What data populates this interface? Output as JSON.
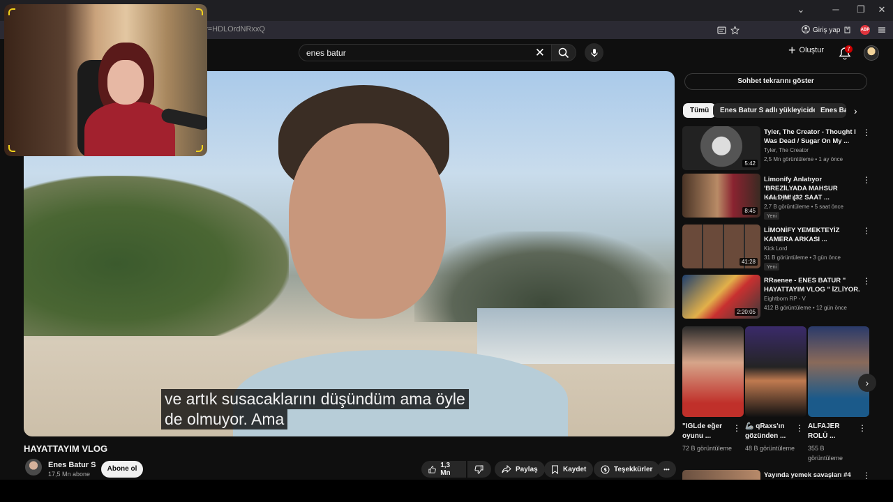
{
  "browser": {
    "url": "h?v=HDLOrdNRxxQ",
    "login_label": "Giriş yap",
    "abp_label": "ABP",
    "min_label": "─",
    "restore_label": "❐",
    "close_label": "✕",
    "tab_dropdown": "⌄"
  },
  "header": {
    "search_value": "enes batur",
    "clear_symbol": "✕",
    "create_label": "Oluştur",
    "notification_count": "7"
  },
  "video": {
    "subtitle_line1": "ve artık susacaklarını düşündüm ama öyle",
    "subtitle_line2": "de olmuyor. Ama",
    "title": "HAYATTAYIM VLOG",
    "channel": "Enes Batur S",
    "subscribers": "17,5 Mn abone",
    "subscribe_label": "Abone ol",
    "like_count": "1,3 Mn",
    "share_label": "Paylaş",
    "save_label": "Kaydet",
    "thanks_label": "Teşekkürler",
    "more_label": "•••"
  },
  "sidebar": {
    "chat_label": "Sohbet tekrarını göster",
    "chips": [
      "Tümü",
      "Enes Batur S adlı yükleyiciden",
      "Enes Ba"
    ],
    "recommendations": [
      {
        "title": "Tyler, The Creator - Thought I Was Dead / Sugar On My ...",
        "channel": "Tyler, The Creator",
        "meta": "2,5 Mn görüntüleme • 1 ay önce",
        "duration": "5:42",
        "badge": ""
      },
      {
        "title": "Limonify Anlatıyor 'BREZİLYADA MAHSUR KALDIM' (32 SAAT ...",
        "channel": "Limonify Clips",
        "meta": "2,7 B görüntüleme • 5 saat önce",
        "duration": "8:45",
        "badge": "Yeni"
      },
      {
        "title": "LİMONİFY YEMEKTEYİZ KAMERA ARKASI ...",
        "channel": "Kick Lord",
        "meta": "31 B görüntüleme • 3 gün önce",
        "duration": "41:28",
        "badge": "Yeni"
      },
      {
        "title": "RRaenee - ENES BATUR \" HAYATTAYIM VLOG \" İZLİYOR.",
        "channel": "Eightborn RP - V",
        "meta": "412 B görüntüleme • 12 gün önce",
        "duration": "2:20:05",
        "badge": ""
      }
    ],
    "shorts": [
      {
        "title": "\"IGLde eğer oyunu ...",
        "views": "72 B görüntüleme"
      },
      {
        "title": "🦾 qRaxs'ın gözünden ...",
        "views": "48 B görüntüleme"
      },
      {
        "title": "ALFAJER ROLÜ ...",
        "views": "355 B görüntüleme"
      }
    ],
    "next_title": "Yayında yemek savaşları #4"
  },
  "colors": {
    "background": "#0f0f0f",
    "accent_red": "#cc0000",
    "webcam_corner": "#f2d21b"
  }
}
